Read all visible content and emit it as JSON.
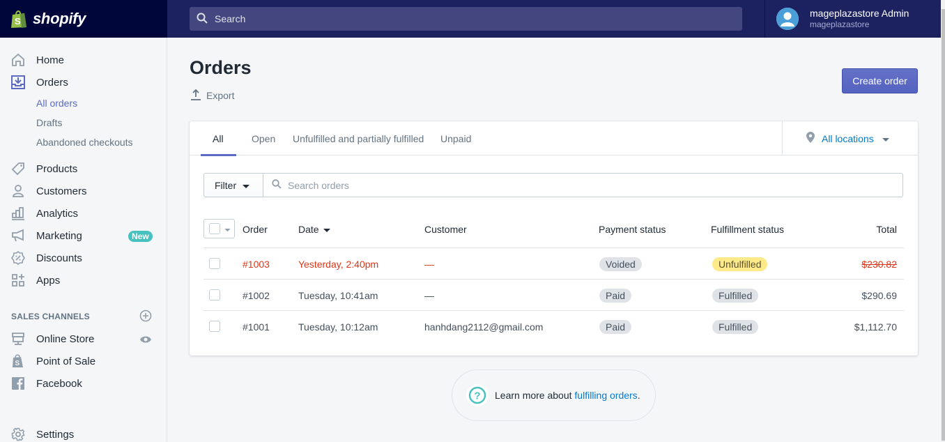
{
  "topbar": {
    "brand": "shopify",
    "search_placeholder": "Search",
    "user_name": "mageplazastore Admin",
    "store_name": "mageplazastore"
  },
  "sidebar": {
    "items": [
      {
        "label": "Home",
        "icon": "home-icon"
      },
      {
        "label": "Orders",
        "icon": "orders-icon",
        "active": true
      },
      {
        "label": "Products",
        "icon": "tag-icon"
      },
      {
        "label": "Customers",
        "icon": "person-icon"
      },
      {
        "label": "Analytics",
        "icon": "bar-chart-icon"
      },
      {
        "label": "Marketing",
        "icon": "megaphone-icon",
        "badge": "New"
      },
      {
        "label": "Discounts",
        "icon": "discount-icon"
      },
      {
        "label": "Apps",
        "icon": "apps-icon"
      }
    ],
    "order_subitems": [
      {
        "label": "All orders",
        "active": true
      },
      {
        "label": "Drafts"
      },
      {
        "label": "Abandoned checkouts"
      }
    ],
    "sales_channels_title": "SALES CHANNELS",
    "channels": [
      {
        "label": "Online Store",
        "icon": "store-icon"
      },
      {
        "label": "Point of Sale",
        "icon": "shopify-bag-icon"
      },
      {
        "label": "Facebook",
        "icon": "facebook-icon"
      }
    ],
    "settings_label": "Settings"
  },
  "page": {
    "title": "Orders",
    "export_label": "Export",
    "create_order_label": "Create order"
  },
  "tabs": [
    {
      "label": "All",
      "active": true
    },
    {
      "label": "Open"
    },
    {
      "label": "Unfulfilled and partially fulfilled"
    },
    {
      "label": "Unpaid"
    }
  ],
  "locations_label": "All locations",
  "filter": {
    "button_label": "Filter",
    "search_placeholder": "Search orders"
  },
  "table": {
    "columns": [
      "Order",
      "Date",
      "Customer",
      "Payment status",
      "Fulfillment status",
      "Total"
    ],
    "rows": [
      {
        "order": "#1003",
        "date": "Yesterday, 2:40pm",
        "customer": "—",
        "payment": "Voided",
        "fulfillment": "Unfulfilled",
        "total": "$230.82",
        "cancelled": true
      },
      {
        "order": "#1002",
        "date": "Tuesday, 10:41am",
        "customer": "—",
        "payment": "Paid",
        "fulfillment": "Fulfilled",
        "total": "$290.69"
      },
      {
        "order": "#1001",
        "date": "Tuesday, 10:12am",
        "customer": "hanhdang2112@gmail.com",
        "payment": "Paid",
        "fulfillment": "Fulfilled",
        "total": "$1,112.70"
      }
    ]
  },
  "help": {
    "prefix": "Learn more about ",
    "link": "fulfilling orders",
    "suffix": "."
  },
  "colors": {
    "accent": "#5c6ac4",
    "link": "#007ace",
    "danger": "#de3618",
    "teal": "#47c1bf",
    "warning_badge": "#ffea8a"
  }
}
